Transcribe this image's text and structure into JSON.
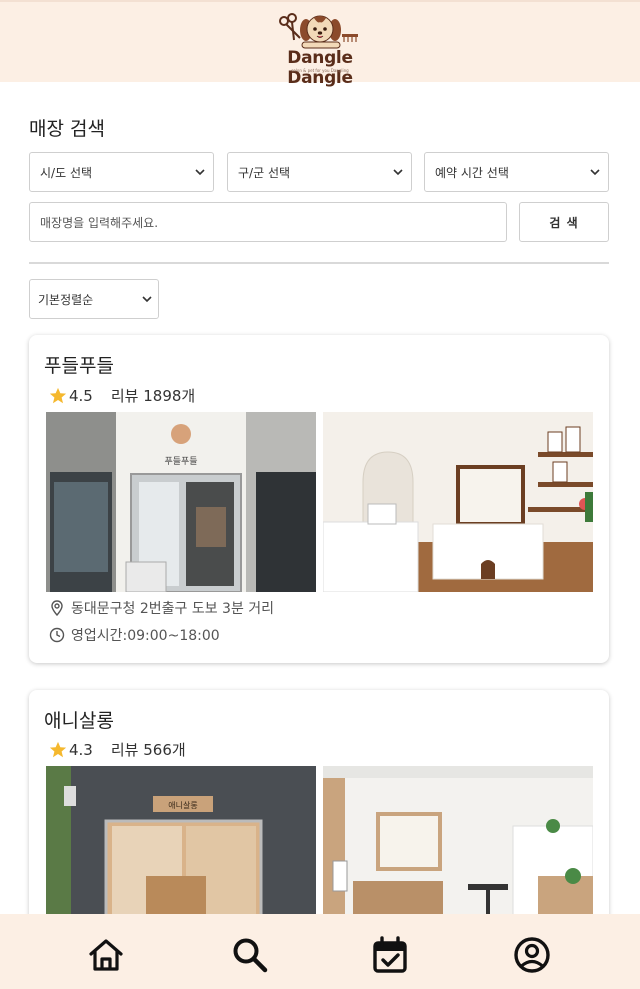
{
  "header": {
    "logo_text": "Dangle Dangle",
    "logo_subtitle": "salon & pet for you Dangling"
  },
  "search": {
    "title": "매장 검색",
    "sido_select": "시/도 선택",
    "gugun_select": "구/군 선택",
    "time_select": "예약 시간 선택",
    "input_placeholder": "매장명을 입력해주세요.",
    "button_label": "검 색"
  },
  "sort": {
    "selected": "기본정렬순"
  },
  "stores": [
    {
      "name": "푸들푸들",
      "rating": "4.5",
      "reviews": "리뷰 1898개",
      "address": "동대문구청 2번출구 도보 3분 거리",
      "hours": "영업시간:09:00~18:00",
      "sign_text": "푸들푸들"
    },
    {
      "name": "애니살롱",
      "rating": "4.3",
      "reviews": "리뷰 566개",
      "sign_text": "애니살롱"
    }
  ],
  "tabbar": {
    "items": [
      "home-icon",
      "search-icon",
      "calendar-check-icon",
      "user-circle-icon"
    ]
  },
  "colors": {
    "header_bg": "#fcefe4",
    "star": "#f5b82e",
    "brand_brown": "#5a2d1a"
  }
}
